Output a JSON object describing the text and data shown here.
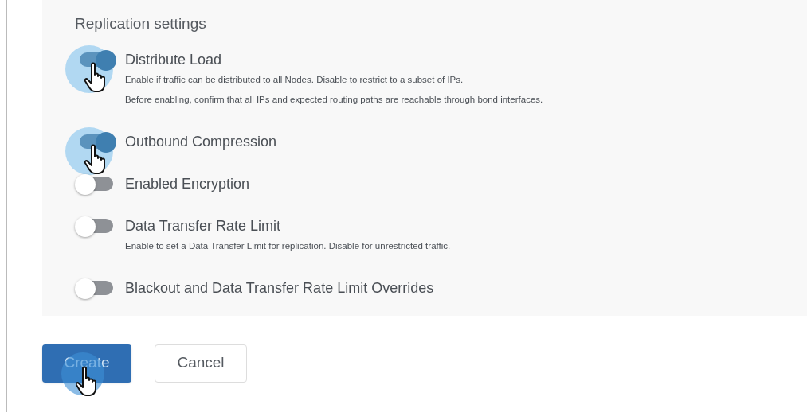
{
  "section_title": "Replication settings",
  "settings": [
    {
      "label": "Distribute Load",
      "on": true,
      "cursor": true,
      "descriptions": [
        "Enable if traffic can be distributed to all Nodes. Disable to restrict to a subset of IPs.",
        "Before enabling, confirm that all IPs and expected routing paths are reachable through bond interfaces."
      ]
    },
    {
      "label": "Outbound Compression",
      "on": true,
      "cursor": true
    },
    {
      "label": "Enabled Encryption",
      "on": false,
      "cursor": false
    },
    {
      "label": "Data Transfer Rate Limit",
      "on": false,
      "cursor": false,
      "descriptions": [
        "Enable to set a Data Transfer Limit for replication. Disable for unrestricted traffic."
      ]
    },
    {
      "label": "Blackout and Data Transfer Rate Limit Overrides",
      "on": false,
      "cursor": false
    }
  ],
  "buttons": [
    {
      "label": "Create",
      "kind": "primary",
      "cursor": true
    },
    {
      "label": "Cancel",
      "kind": "secondary",
      "cursor": false
    }
  ]
}
